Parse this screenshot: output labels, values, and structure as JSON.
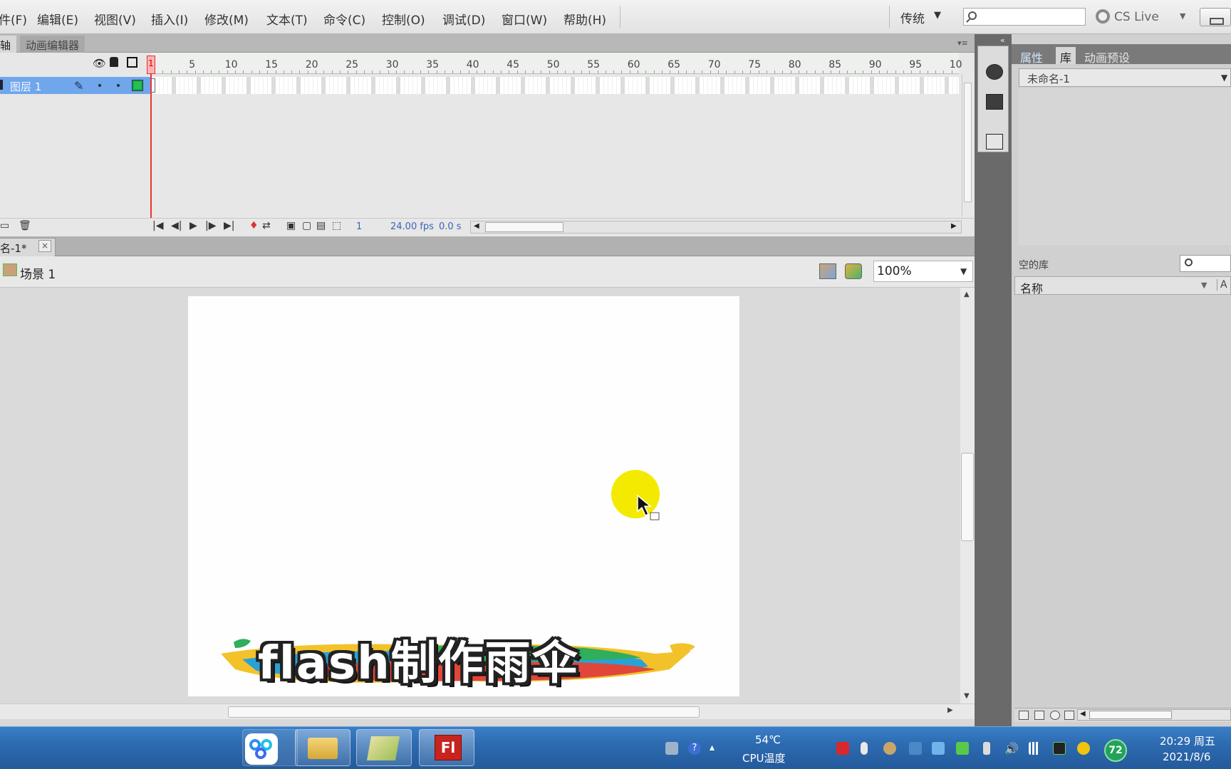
{
  "menubar": {
    "items": [
      "件(F)",
      "编辑(E)",
      "视图(V)",
      "插入(I)",
      "修改(M)",
      "文本(T)",
      "命令(C)",
      "控制(O)",
      "调试(D)",
      "窗口(W)",
      "帮助(H)"
    ],
    "workspace": "传统",
    "cslive": "CS Live"
  },
  "timeline": {
    "tabs": [
      "轴",
      "动画编辑器"
    ],
    "ruler_numbers": [
      "5",
      "10",
      "15",
      "20",
      "25",
      "30",
      "35",
      "40",
      "45",
      "50",
      "55",
      "60",
      "65",
      "70",
      "75",
      "80",
      "85",
      "90",
      "95",
      "10"
    ],
    "playhead_frame": "1",
    "layer_name": "图层 1",
    "current_frame": "1",
    "fps": "24.00 fps",
    "elapsed": "0.0 s"
  },
  "document": {
    "tab_label": "名-1*",
    "close_glyph": "×",
    "scene": "场景 1",
    "zoom": "100%"
  },
  "stage": {
    "background": "#ffffff",
    "title_text": "flash制作雨伞"
  },
  "right_panel": {
    "tabs": [
      "属性",
      "库",
      "动画预设"
    ],
    "library_doc": "未命名-1",
    "empty_label": "空的库",
    "column_name": "名称",
    "column_as": "A"
  },
  "taskbar": {
    "cpu_temp": "54℃",
    "cpu_label": "CPU温度",
    "badge": "72",
    "time": "20:29 周五",
    "date": "2021/8/6"
  },
  "colors": {
    "accent_layer": "#6fa6ec",
    "playhead": "#ee3333",
    "cursor_halo": "#f4ea00",
    "taskbar": "#2d6bb1"
  }
}
